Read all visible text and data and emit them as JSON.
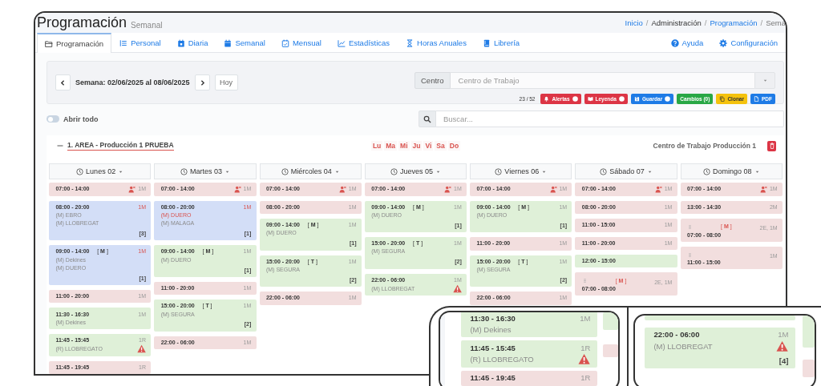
{
  "header": {
    "title": "Programación",
    "subtitle": "Semanal",
    "breadcrumb": [
      {
        "kind": "link",
        "text": "Inicio"
      },
      {
        "kind": "separator",
        "text": "/"
      },
      {
        "kind": "text",
        "text": "Administración"
      },
      {
        "kind": "separator",
        "text": "/"
      },
      {
        "kind": "link",
        "text": "Programación"
      },
      {
        "kind": "separator",
        "text": "/"
      },
      {
        "kind": "current",
        "text": "Sema"
      }
    ]
  },
  "tabs": [
    {
      "label": "Programación",
      "selected": true
    },
    {
      "label": "Personal",
      "selected": false
    },
    {
      "label": "Diaria",
      "selected": false
    },
    {
      "label": "Semanal",
      "selected": false
    },
    {
      "label": "Mensual",
      "selected": false
    },
    {
      "label": "Estadísticas",
      "selected": false
    },
    {
      "label": "Horas Anuales",
      "selected": false
    },
    {
      "label": "Librería",
      "selected": false
    }
  ],
  "tab_links": [
    {
      "label": "Ayuda"
    },
    {
      "label": "Configuración"
    }
  ],
  "week": {
    "label": "Semana: 02/06/2025 al 08/06/2025",
    "today_button": "Hoy"
  },
  "centro": {
    "label": "Centro",
    "placeholder": "Centro de Trabajo"
  },
  "counter": "23 / 52",
  "actions": [
    {
      "label": "Alertas",
      "color": "#dc3545",
      "help": true
    },
    {
      "label": "Leyenda",
      "color": "#dc3545",
      "help": true
    },
    {
      "label": "Guardar",
      "color": "#1e7be6",
      "help": true
    },
    {
      "label": "Cambios (0)",
      "color": "#28a745",
      "help": false
    },
    {
      "label": "Clonar",
      "color": "#f4c20d",
      "help": false
    },
    {
      "label": "PDF",
      "color": "#1e7be6",
      "help": false
    }
  ],
  "expand_all": {
    "label": "Abrir todo",
    "on": false
  },
  "search": {
    "placeholder": "Buscar..."
  },
  "area": {
    "title": "1. AREA - Producción 1 PRUEBA",
    "expanded": true,
    "weekdays": [
      "Lu",
      "Ma",
      "Mi",
      "Ju",
      "Vi",
      "Sa",
      "Do"
    ],
    "work_center": "Centro de Trabajo Producción 1"
  },
  "days": [
    {
      "label": "Lunes 02",
      "shifts": [
        {
          "kind": "standard",
          "color": "#f2dede",
          "time": "07:00 - 14:00",
          "count": "1M",
          "staff_icon": true,
          "warning": false
        },
        {
          "kind": "standard",
          "color": "#d3def7",
          "time": "08:00 - 20:00",
          "count": "1M",
          "staff_icon": false,
          "warning": false,
          "names": [
            {
              "text": "(M) EBRO",
              "highlighted": false
            },
            {
              "text": "(M) LLOBREGAT",
              "highlighted": false
            }
          ],
          "badge": "[3]"
        },
        {
          "kind": "standard",
          "color": "#d3def7",
          "time": "09:00 - 14:00",
          "tag": "[ **M** ]",
          "count": "1M",
          "staff_icon": false,
          "warning": false,
          "names": [
            {
              "text": "(M) Dekines",
              "highlighted": false
            },
            {
              "text": "(M) DUERO",
              "highlighted": false
            }
          ],
          "badge": "[1]"
        },
        {
          "kind": "standard",
          "color": "#f2dede",
          "time": "11:00 - 20:00",
          "count": "1M",
          "staff_icon": false,
          "warning": false
        },
        {
          "kind": "standard",
          "color": "#dff0d8",
          "time": "11:30 - 16:30",
          "count": "1M",
          "staff_icon": false,
          "warning": false,
          "names": [
            {
              "text": "(M) Dekines",
              "highlighted": false
            }
          ]
        },
        {
          "kind": "standard",
          "color": "#dff0d8",
          "time": "11:45 - 15:45",
          "count": "1R",
          "staff_icon": false,
          "warning": true,
          "names": [
            {
              "text": "(R) LLOBREGATO",
              "highlighted": false
            }
          ]
        },
        {
          "kind": "standard",
          "color": "#f2dede",
          "time": "11:45 - 19:45",
          "count": "1R",
          "staff_icon": false,
          "warning": false
        }
      ]
    },
    {
      "label": "Martes 03",
      "shifts": [
        {
          "kind": "standard",
          "color": "#f2dede",
          "time": "07:00 - 14:00",
          "count": "1M",
          "staff_icon": true,
          "warning": false
        },
        {
          "kind": "standard",
          "color": "#d3def7",
          "time": "08:00 - 20:00",
          "count": "1M",
          "staff_icon": false,
          "warning": false,
          "names": [
            {
              "text": "(M) DUERO",
              "highlighted": true
            },
            {
              "text": "(M) MALAGA",
              "highlighted": false
            }
          ],
          "badge": "[1]"
        },
        {
          "kind": "standard",
          "color": "#dff0d8",
          "time": "09:00 - 14:00",
          "tag": "[ **M** ]",
          "count": "1M",
          "staff_icon": false,
          "warning": false,
          "names": [
            {
              "text": "(M) DUERO",
              "highlighted": false
            }
          ],
          "badge": "[1]"
        },
        {
          "kind": "standard",
          "color": "#f2dede",
          "time": "11:00 - 20:00",
          "count": "1M",
          "staff_icon": false,
          "warning": false
        },
        {
          "kind": "standard",
          "color": "#dff0d8",
          "time": "15:00 - 20:00",
          "tag": "[ **T** ]",
          "count": "1M",
          "staff_icon": false,
          "warning": false,
          "names": [
            {
              "text": "(M) SEGURA",
              "highlighted": false
            }
          ],
          "badge": "[2]"
        },
        {
          "kind": "standard",
          "color": "#f2dede",
          "time": "22:00 - 06:00",
          "count": "1M",
          "staff_icon": false,
          "warning": false
        }
      ]
    },
    {
      "label": "Miércoles 04",
      "shifts": [
        {
          "kind": "standard",
          "color": "#f2dede",
          "time": "07:00 - 14:00",
          "count": "1M",
          "staff_icon": true,
          "warning": false
        },
        {
          "kind": "standard",
          "color": "#f2dede",
          "time": "08:00 - 20:00",
          "count": "1M",
          "staff_icon": false,
          "warning": false
        },
        {
          "kind": "standard",
          "color": "#dff0d8",
          "time": "09:00 - 14:00",
          "tag": "[ **M** ]",
          "count": "1M",
          "staff_icon": false,
          "warning": false,
          "names": [
            {
              "text": "(M) DUERO",
              "highlighted": false
            }
          ],
          "badge": "[1]"
        },
        {
          "kind": "standard",
          "color": "#dff0d8",
          "time": "15:00 - 20:00",
          "tag": "[ **T** ]",
          "count": "1M",
          "staff_icon": false,
          "warning": false,
          "names": [
            {
              "text": "(M) SEGURA",
              "highlighted": false
            }
          ],
          "badge": "[2]"
        },
        {
          "kind": "standard",
          "color": "#f2dede",
          "time": "22:00 - 06:00",
          "count": "1M",
          "staff_icon": false,
          "warning": false
        }
      ]
    },
    {
      "label": "Jueves 05",
      "shifts": [
        {
          "kind": "standard",
          "color": "#f2dede",
          "time": "07:00 - 14:00",
          "count": "1M",
          "staff_icon": true,
          "warning": false
        },
        {
          "kind": "standard",
          "color": "#dff0d8",
          "time": "09:00 - 14:00",
          "tag": "[ **M** ]",
          "count": "1M",
          "staff_icon": false,
          "warning": false,
          "names": [
            {
              "text": "(M) DUERO",
              "highlighted": false
            }
          ],
          "badge": "[1]"
        },
        {
          "kind": "standard",
          "color": "#dff0d8",
          "time": "15:00 - 20:00",
          "tag": "[ **T** ]",
          "count": "1M",
          "staff_icon": false,
          "warning": false,
          "names": [
            {
              "text": "(M) SEGURA",
              "highlighted": false
            }
          ],
          "badge": "[2]"
        },
        {
          "kind": "standard",
          "color": "#dff0d8",
          "time": "22:00 - 06:00",
          "count": "1M",
          "staff_icon": false,
          "warning": true,
          "names": [
            {
              "text": "(M) LLOBREGAT",
              "highlighted": false
            }
          ]
        }
      ]
    },
    {
      "label": "Viernes 06",
      "shifts": [
        {
          "kind": "standard",
          "color": "#f2dede",
          "time": "07:00 - 14:00",
          "count": "1M",
          "staff_icon": true,
          "warning": false
        },
        {
          "kind": "standard",
          "color": "#dff0d8",
          "time": "09:00 - 14:00",
          "tag": "[ **M** ]",
          "count": "1M",
          "staff_icon": false,
          "warning": false,
          "names": [
            {
              "text": "(M) DUERO",
              "highlighted": false
            }
          ],
          "badge": "[1]"
        },
        {
          "kind": "standard",
          "color": "#f2dede",
          "time": "11:00 - 20:00",
          "count": "1M",
          "staff_icon": false,
          "warning": false
        },
        {
          "kind": "standard",
          "color": "#dff0d8",
          "time": "15:00 - 20:00",
          "tag": "[ **T** ]",
          "count": "1M",
          "staff_icon": false,
          "warning": false,
          "names": [
            {
              "text": "(M) SEGURA",
              "highlighted": false
            }
          ],
          "badge": "[2]"
        },
        {
          "kind": "standard",
          "color": "#f2dede",
          "time": "22:00 - 06:00",
          "count": "1M",
          "staff_icon": false,
          "warning": false
        }
      ]
    },
    {
      "label": "Sábado 07",
      "shifts": [
        {
          "kind": "standard",
          "color": "#f2dede",
          "time": "07:00 - 14:00",
          "count": "1M",
          "staff_icon": true,
          "warning": false
        },
        {
          "kind": "standard",
          "color": "#f2dede",
          "time": "08:00 - 20:00",
          "count": "1M",
          "staff_icon": false,
          "warning": false
        },
        {
          "kind": "standard",
          "color": "#f2dede",
          "time": "11:00 - 15:00",
          "count": "1M",
          "staff_icon": false,
          "warning": false
        },
        {
          "kind": "standard",
          "color": "#f2dede",
          "time": "11:00 - 20:00",
          "count": "1M",
          "staff_icon": false,
          "warning": false
        },
        {
          "kind": "standard",
          "color": "#dff0d8",
          "time": "12:00 - 15:00",
          "staff_icon": false,
          "warning": false
        },
        {
          "kind": "split",
          "color": "#f2dede",
          "time": "07:00 - 08:00",
          "tag": "[ **M** ]",
          "count": "2E, 1M",
          "staff_icon": false,
          "warning": false
        }
      ]
    },
    {
      "label": "Domingo 08",
      "shifts": [
        {
          "kind": "standard",
          "color": "#f2dede",
          "time": "07:00 - 14:00",
          "count": "1M",
          "staff_icon": true,
          "warning": false
        },
        {
          "kind": "standard",
          "color": "#f2dede",
          "time": "13:00 - 14:30",
          "count": "2M",
          "staff_icon": false,
          "warning": false
        },
        {
          "kind": "split",
          "color": "#f2dede",
          "time": "07:00 - 08:00",
          "tag": "[ **M** ]",
          "count": "2E, 1M",
          "staff_icon": false,
          "warning": false
        },
        {
          "kind": "split",
          "color": "#f2dede",
          "time": "11:00 - 15:00",
          "count": "1M",
          "staff_icon": false,
          "warning": false
        }
      ]
    }
  ],
  "callouts": [
    {
      "shifts": [
        {
          "kind": "standard",
          "color": "#dff0d8",
          "time": "11:30 - 16:30",
          "count": "1M",
          "staff_icon": false,
          "warning": false,
          "names": [
            {
              "text": "(M) Dekines",
              "highlighted": false
            }
          ]
        },
        {
          "kind": "standard",
          "color": "#dff0d8",
          "time": "11:45 - 15:45",
          "count": "1R",
          "staff_icon": false,
          "warning": true,
          "names": [
            {
              "text": "(R) LLOBREGATO",
              "highlighted": false
            }
          ]
        },
        {
          "kind": "standard",
          "color": "#f2dede",
          "time": "11:45 - 19:45",
          "count": "1R",
          "staff_icon": false,
          "warning": false
        }
      ]
    },
    {
      "shifts": [
        {
          "kind": "standard",
          "color": "#dff0d8",
          "time": "22:00 - 06:00",
          "count": "1M",
          "staff_icon": false,
          "warning": true,
          "names": [
            {
              "text": "(M) LLOBREGAT",
              "highlighted": false
            }
          ],
          "badge": "[4]"
        }
      ]
    }
  ]
}
